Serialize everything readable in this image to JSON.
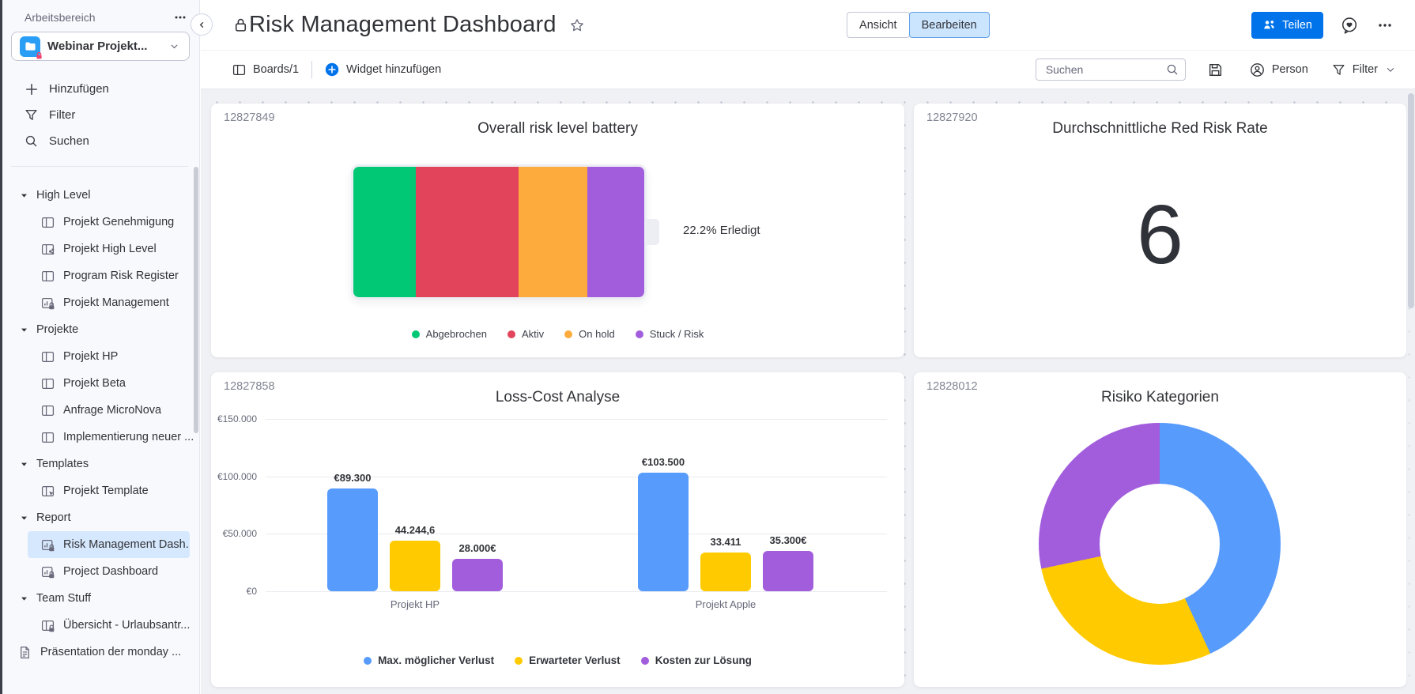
{
  "app": {
    "accent_color": "#0073ea"
  },
  "sidebar": {
    "workspace_label": "Arbeitsbereich",
    "workspace": {
      "name": "Webinar Projekt...",
      "icon": "workspace-folder-icon",
      "badge": "lock"
    },
    "menu": [
      {
        "icon": "plus",
        "label": "Hinzufügen"
      },
      {
        "icon": "funnel",
        "label": "Filter"
      },
      {
        "icon": "search",
        "label": "Suchen"
      }
    ],
    "tree": [
      {
        "type": "section",
        "label": "High Level"
      },
      {
        "type": "item",
        "icon": "board",
        "label": "Projekt Genehmigung"
      },
      {
        "type": "item",
        "icon": "board-connect",
        "label": "Projekt High Level"
      },
      {
        "type": "item",
        "icon": "board",
        "label": "Program Risk Register"
      },
      {
        "type": "item",
        "icon": "dashboard-lock",
        "label": "Projekt Management"
      },
      {
        "type": "section",
        "label": "Projekte"
      },
      {
        "type": "item",
        "icon": "board",
        "label": "Projekt HP"
      },
      {
        "type": "item",
        "icon": "board",
        "label": "Projekt Beta"
      },
      {
        "type": "item",
        "icon": "board",
        "label": "Anfrage MicroNova"
      },
      {
        "type": "item",
        "icon": "board",
        "label": "Implementierung neuer ..."
      },
      {
        "type": "section",
        "label": "Templates"
      },
      {
        "type": "item",
        "icon": "board-template",
        "label": "Projekt Template"
      },
      {
        "type": "section",
        "label": "Report"
      },
      {
        "type": "item",
        "icon": "dashboard-lock",
        "label": "Risk Management Dash...",
        "selected": true
      },
      {
        "type": "item",
        "icon": "dashboard-lock",
        "label": "Project Dashboard"
      },
      {
        "type": "section",
        "label": "Team Stuff"
      },
      {
        "type": "item",
        "icon": "board-lock",
        "label": "Übersicht - Urlaubsantr..."
      },
      {
        "type": "doc",
        "icon": "doc",
        "label": "Präsentation der monday ..."
      }
    ]
  },
  "header": {
    "title": "Risk Management Dashboard",
    "view_button": "Ansicht",
    "edit_button": "Bearbeiten",
    "share_button": "Teilen"
  },
  "toolbar": {
    "boards": "Boards/1",
    "add_widget": "Widget hinzufügen",
    "search_placeholder": "Suchen",
    "person": "Person",
    "filter": "Filter"
  },
  "widgets": {
    "battery": {
      "widget_id": "12827849",
      "title": "Overall risk level battery",
      "done_label": "22.2% Erledigt",
      "chart_data": {
        "type": "battery",
        "done_percent": 22.2,
        "segments": [
          {
            "label": "Abgebrochen",
            "color": "#00c875",
            "percent": 21.4
          },
          {
            "label": "Aktiv",
            "color": "#e2445c",
            "percent": 35.3
          },
          {
            "label": "On hold",
            "color": "#fdab3d",
            "percent": 23.8
          },
          {
            "label": "Stuck / Risk",
            "color": "#a25ddc",
            "percent": 19.5
          }
        ]
      }
    },
    "number": {
      "widget_id": "12827920",
      "title": "Durchschnittliche Red Risk Rate",
      "value": "6"
    },
    "bars": {
      "widget_id": "12827858",
      "title": "Loss-Cost Analyse",
      "chart_data": {
        "type": "bar",
        "categories": [
          "Projekt HP",
          "Projekt Apple"
        ],
        "series": [
          {
            "name": "Max. möglicher Verlust",
            "color": "#579bfc",
            "values": [
              89300,
              103500
            ],
            "labels": [
              "€89.300",
              "€103.500"
            ]
          },
          {
            "name": "Erwarteter Verlust",
            "color": "#ffcb00",
            "values": [
              44244.6,
              33411
            ],
            "labels": [
              "44.244,6",
              "33.411"
            ]
          },
          {
            "name": "Kosten zur Lösung",
            "color": "#a25ddc",
            "values": [
              28000,
              35300
            ],
            "labels": [
              "28.000€",
              "35.300€"
            ]
          }
        ],
        "ylim": [
          0,
          150000
        ],
        "yticks": [
          {
            "value": 150000,
            "label": "€150.000"
          },
          {
            "value": 100000,
            "label": "€100.000"
          },
          {
            "value": 50000,
            "label": "€50.000"
          },
          {
            "value": 0,
            "label": "€0"
          }
        ],
        "grid": true,
        "legend_position": "bottom"
      }
    },
    "donut": {
      "widget_id": "12828012",
      "title": "Risiko Kategorien",
      "chart_data": {
        "type": "donut",
        "slices": [
          {
            "color": "#579bfc",
            "percent": 43.1
          },
          {
            "color": "#ffcb00",
            "percent": 28.6
          },
          {
            "color": "#a25ddc",
            "percent": 28.3
          }
        ]
      }
    }
  }
}
